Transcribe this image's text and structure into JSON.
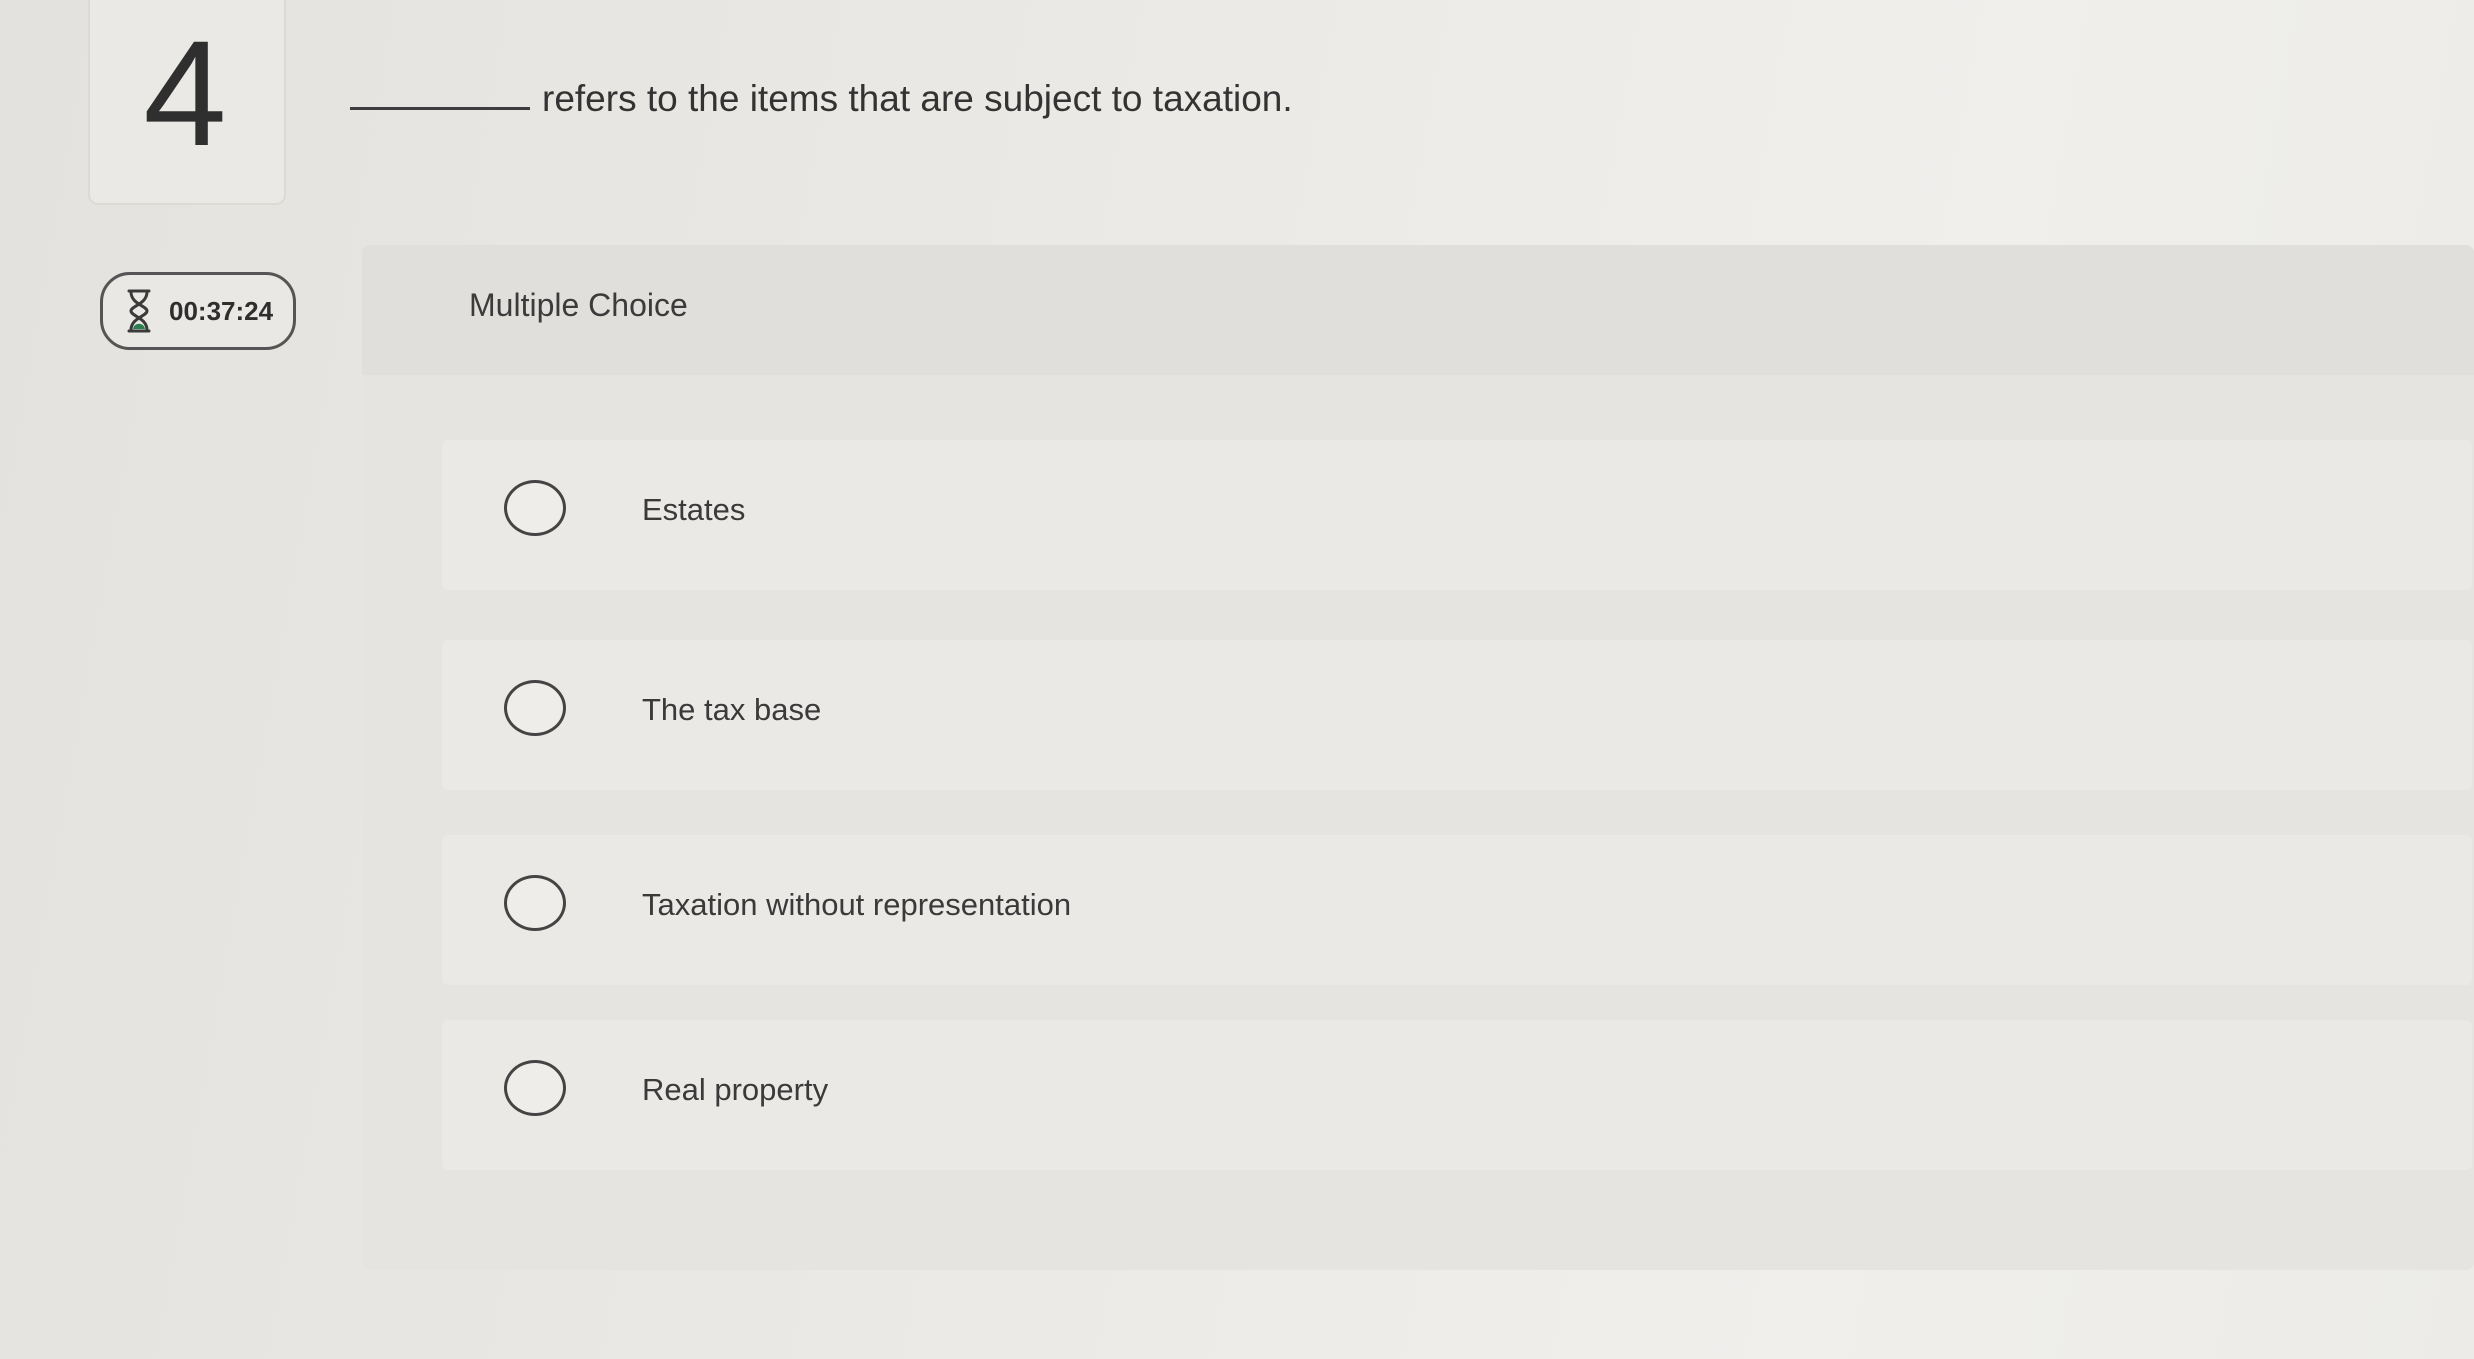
{
  "question": {
    "number": "4",
    "text": "refers to the items that are subject to taxation."
  },
  "timer": {
    "icon": "hourglass-icon",
    "time": "00:37:24"
  },
  "panel": {
    "title": "Multiple Choice"
  },
  "choices": [
    {
      "label": "Estates"
    },
    {
      "label": "The tax base"
    },
    {
      "label": "Taxation without representation"
    },
    {
      "label": "Real property"
    }
  ],
  "colors": {
    "background": "#ebe9e5",
    "panel": "#e6e4e0",
    "text": "#3a3a3a"
  }
}
